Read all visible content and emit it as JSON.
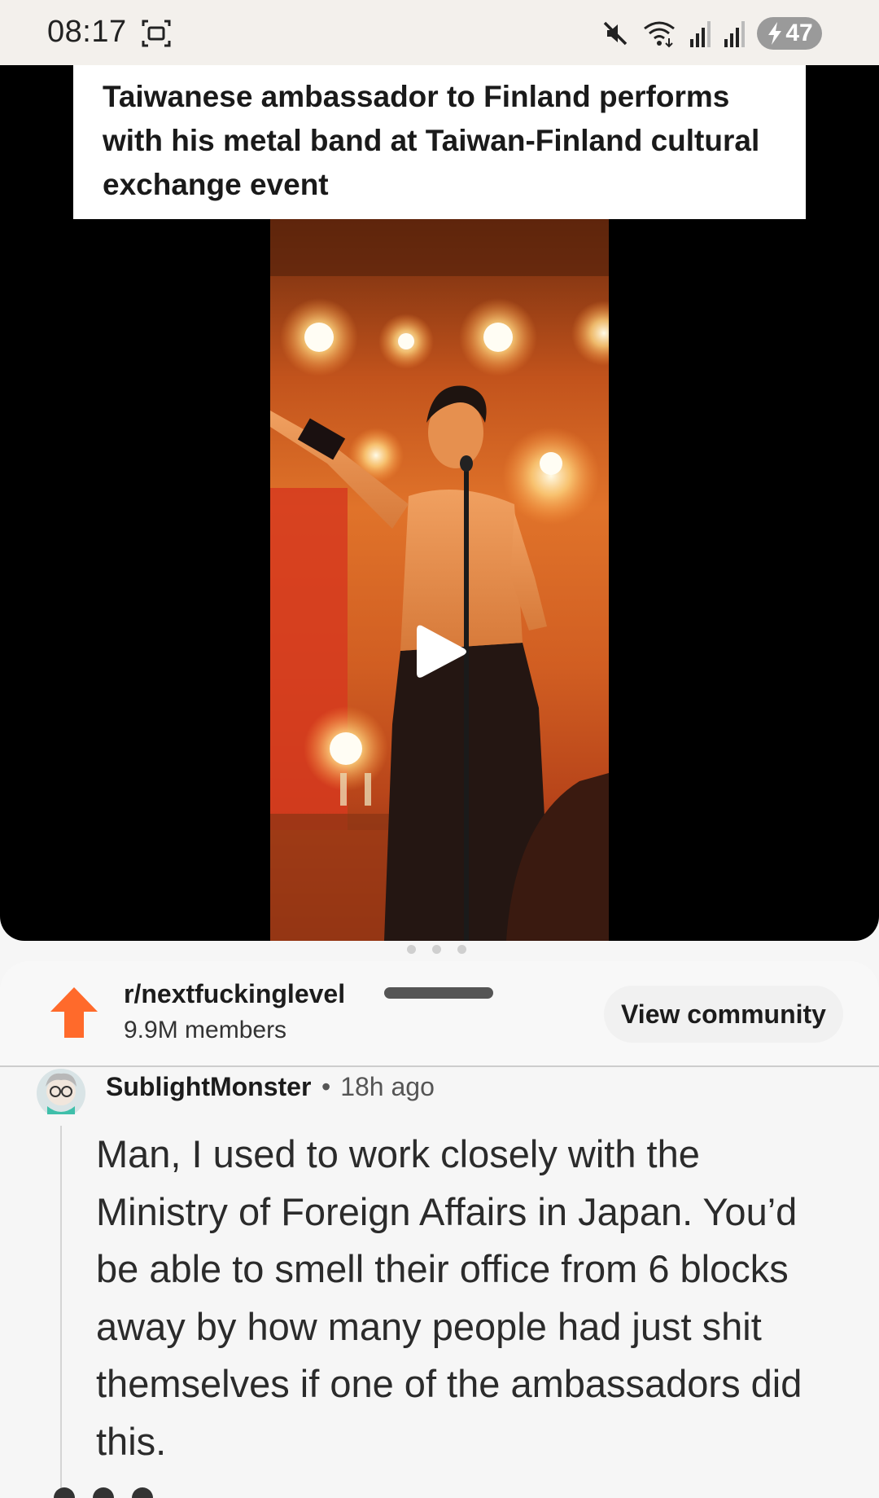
{
  "status_bar": {
    "time": "08:17",
    "battery_level": "47",
    "icons": [
      "screenshot-icon",
      "mute-icon",
      "wifi-icon",
      "signal-icon",
      "signal-icon",
      "charging-icon"
    ]
  },
  "post": {
    "headline": "Taiwanese ambassador to Finland performs with his metal band at Taiwan-Finland cultural exchange event",
    "media_type": "video",
    "media_icon": "play-icon"
  },
  "community": {
    "name": "r/nextfuckinglevel",
    "members": "9.9M members",
    "view_label": "View community",
    "icon": "upvote-arrow-icon",
    "accent_color": "#ff6a2b"
  },
  "comment": {
    "author": "SublightMonster",
    "separator": "•",
    "age": "18h ago",
    "body": "Man, I used to work closely with the Ministry of Foreign Affairs in Japan. You’d be able to smell their office from 6 blocks away by how many people had just shit themselves if one of the ambassadors did this."
  }
}
